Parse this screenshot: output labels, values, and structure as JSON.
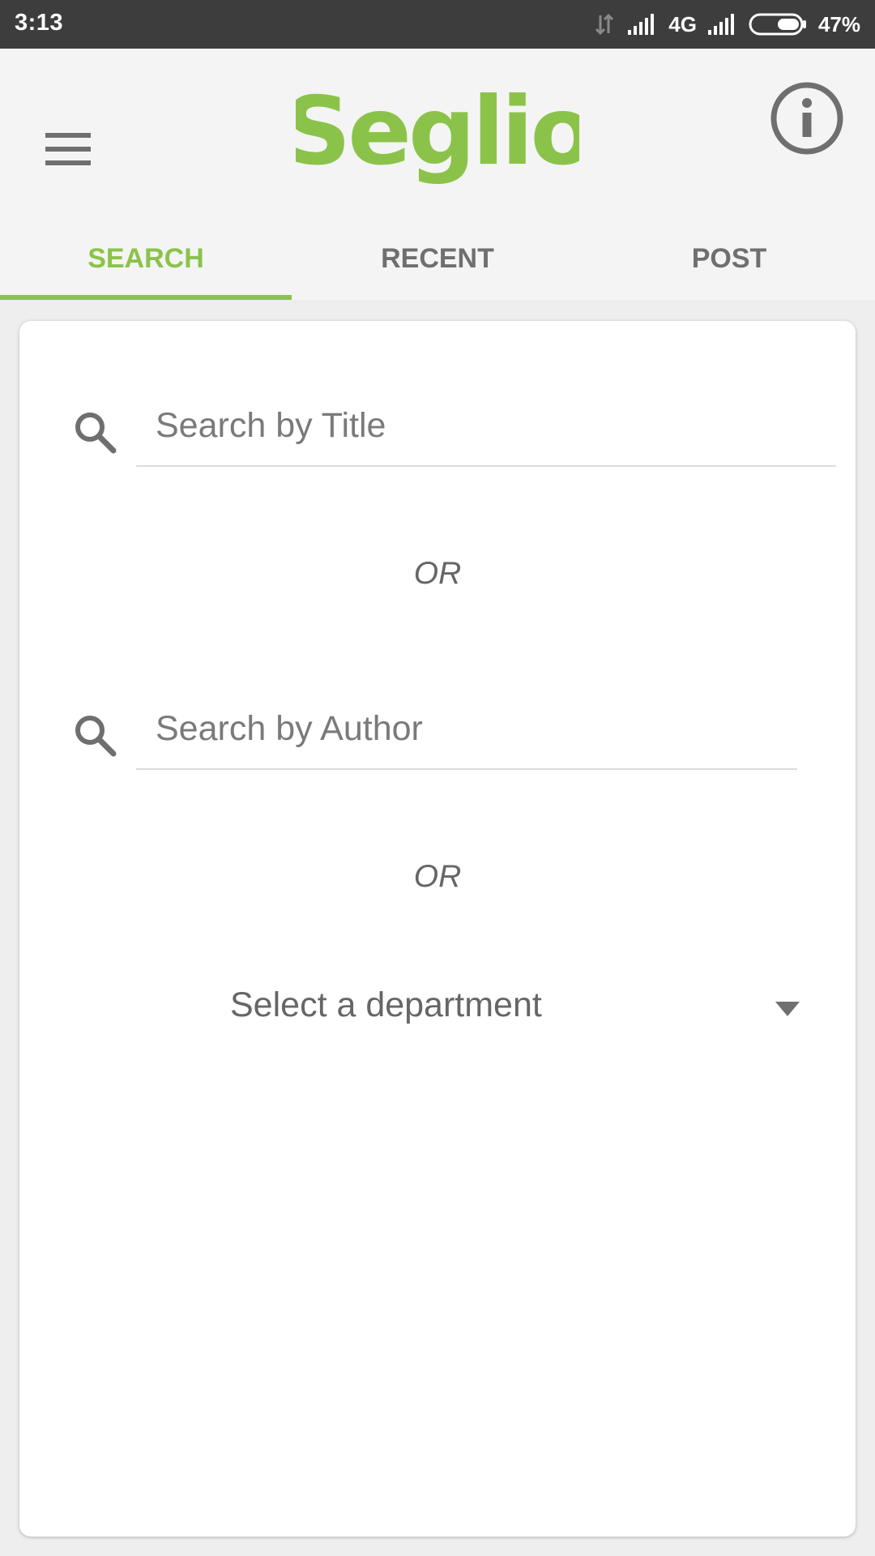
{
  "status_bar": {
    "time": "3:13",
    "network": "4G",
    "battery": "47%"
  },
  "app_bar": {
    "logo_text": "Seglio",
    "menu_icon": "hamburger-menu-icon",
    "info_icon": "info-icon"
  },
  "tabs": [
    {
      "label": "SEARCH",
      "active": true
    },
    {
      "label": "RECENT",
      "active": false
    },
    {
      "label": "POST",
      "active": false
    }
  ],
  "search": {
    "title_placeholder": "Search by Title",
    "title_value": "",
    "author_placeholder": "Search by Author",
    "author_value": "",
    "or_label_1": "OR",
    "or_label_2": "OR",
    "department_label": "Select a department"
  },
  "colors": {
    "accent": "#8bc34a",
    "status_bar": "#3d3d3d",
    "icon": "#6f6f6f"
  }
}
